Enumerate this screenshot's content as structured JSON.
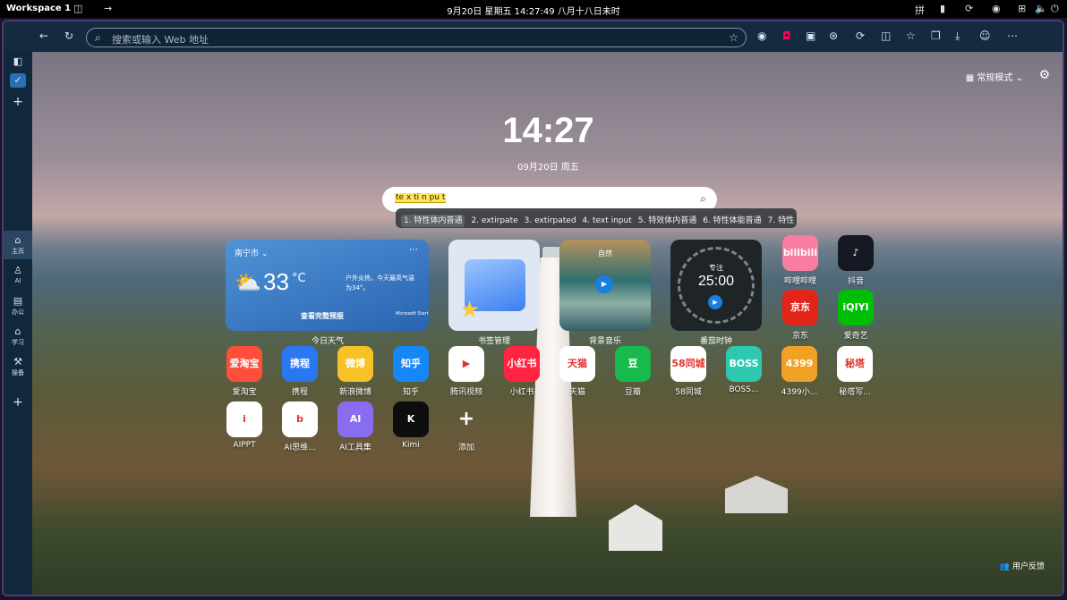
{
  "system_bar": {
    "workspace": "Workspace 1",
    "datetime": "9月20日 星期五 14:27:49  八月十八日未时",
    "input_method": "拼"
  },
  "browser": {
    "address_placeholder": "搜索或输入 Web 地址"
  },
  "sidebar": {
    "items": [
      {
        "label": "主页",
        "icon": "home-icon"
      },
      {
        "label": "AI",
        "icon": "ai-bot-icon"
      },
      {
        "label": "办公",
        "icon": "office-icon"
      },
      {
        "label": "学习",
        "icon": "graduation-cap-icon"
      },
      {
        "label": "操备",
        "icon": "tools-icon"
      }
    ]
  },
  "newtab": {
    "mode_label": "常规模式",
    "time": "14:27",
    "date": "09月20日 周五",
    "search_text": "te x ti n pu t",
    "ime_candidates": [
      "1. 特性体内普通",
      "2. extirpate",
      "3. extirpated",
      "4. text input",
      "5. 特效体内普通",
      "6. 特性体能普通",
      "7. 特性"
    ],
    "widgets": {
      "weather": {
        "city": "南宁市",
        "temp": "33",
        "unit": "°C",
        "tip": "户外炎热，今天最高气温为34°。",
        "forecast_link": "查看完整预报",
        "brand": "Microsoft Start",
        "label": "今日天气"
      },
      "bookmark": {
        "label": "书签管理"
      },
      "music": {
        "title": "自然",
        "label": "背景音乐"
      },
      "focus": {
        "title": "专注",
        "value": "25:00",
        "label": "番茄时钟"
      }
    },
    "apps": [
      {
        "name": "哔哩哔哩",
        "logo": "bilibili",
        "color": "#f87ea1"
      },
      {
        "name": "抖音",
        "logo": "♪",
        "color": "#161823"
      },
      {
        "name": "京东",
        "logo": "京东",
        "color": "#e1251b"
      },
      {
        "name": "爱奇艺",
        "logo": "iQIYI",
        "color": "#00be06"
      },
      {
        "name": "爱淘宝",
        "logo": "爱淘宝",
        "color": "#ff4f3b"
      },
      {
        "name": "携程",
        "logo": "携程",
        "color": "#2a78f0"
      },
      {
        "name": "新浪微博",
        "logo": "微博",
        "color": "#f7c227"
      },
      {
        "name": "知乎",
        "logo": "知乎",
        "color": "#1687f6"
      },
      {
        "name": "腾讯视频",
        "logo": "▶",
        "color": "#ffffff"
      },
      {
        "name": "小红书",
        "logo": "小红书",
        "color": "#ff2442"
      },
      {
        "name": "天猫",
        "logo": "天猫",
        "color": "#ffffff"
      },
      {
        "name": "豆瓣",
        "logo": "豆",
        "color": "#18b94d"
      },
      {
        "name": "58同城",
        "logo": "58同城",
        "color": "#ffffff"
      },
      {
        "name": "BOSS...",
        "logo": "BOSS",
        "color": "#2ec8b0"
      },
      {
        "name": "4399小...",
        "logo": "4399",
        "color": "#f1a226"
      },
      {
        "name": "秘塔写...",
        "logo": "秘塔",
        "color": "#ffffff"
      },
      {
        "name": "AIPPT",
        "logo": "i",
        "color": "#ffffff"
      },
      {
        "name": "AI思维...",
        "logo": "b",
        "color": "#ffffff"
      },
      {
        "name": "AI工具集",
        "logo": "AI",
        "color": "#8a6cf0"
      },
      {
        "name": "Kimi",
        "logo": "K",
        "color": "#0d0d0d"
      },
      {
        "name": "添加",
        "logo": "+",
        "color": "transparent"
      }
    ],
    "feedback": "用户反馈"
  }
}
